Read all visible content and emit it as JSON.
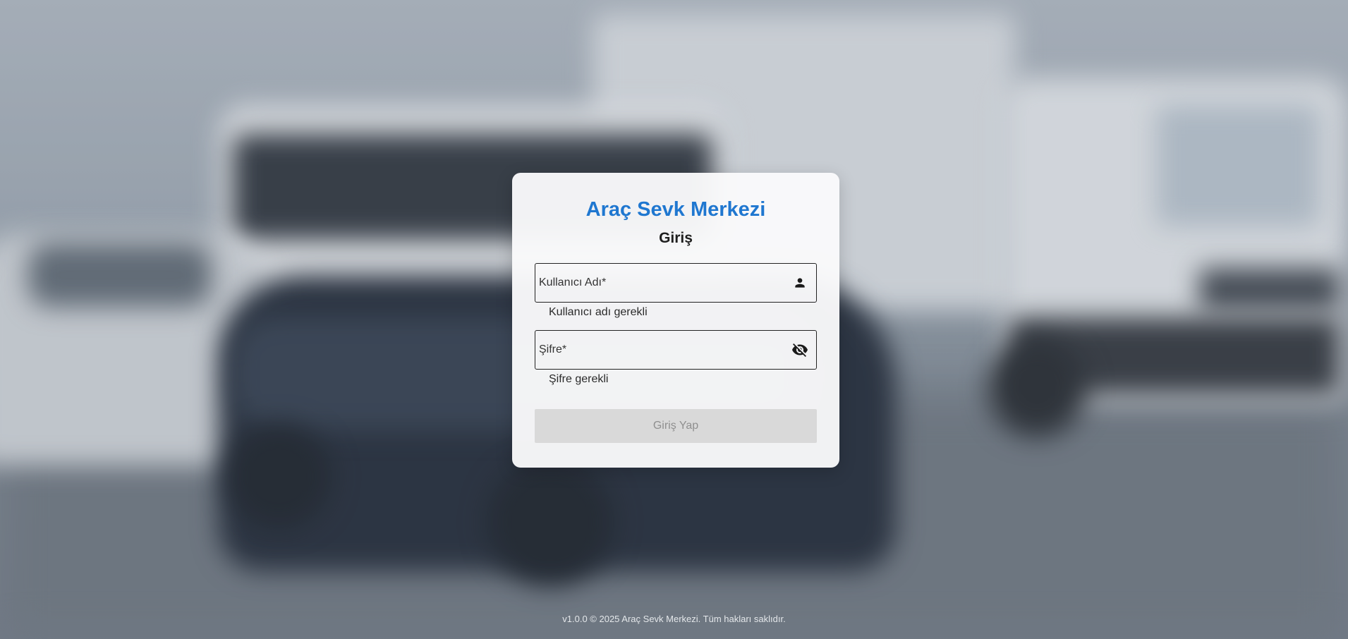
{
  "app": {
    "title": "Araç Sevk Merkezi",
    "subtitle": "Giriş"
  },
  "form": {
    "username": {
      "placeholder": "Kullanıcı Adı*",
      "value": "",
      "helper": "Kullanıcı adı gerekli",
      "icon": "person-icon"
    },
    "password": {
      "placeholder": "Şifre*",
      "value": "",
      "helper": "Şifre gerekli",
      "icon": "eye-off-icon"
    },
    "submit_label": "Giriş Yap",
    "submit_disabled": true
  },
  "footer": {
    "text": "v1.0.0 © 2025 Araç Sevk Merkezi. Tüm hakları saklıdır."
  },
  "colors": {
    "brand": "#1f77d0",
    "button_disabled_bg": "#d9d9d9",
    "button_disabled_text": "#8f8f8f"
  }
}
